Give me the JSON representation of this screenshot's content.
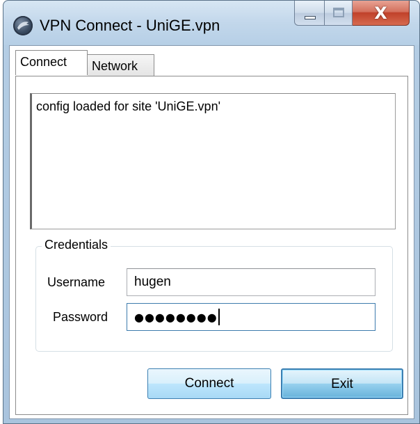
{
  "window": {
    "title": "VPN Connect - UniGE.vpn",
    "close_glyph": "X"
  },
  "tabs": [
    {
      "label": "Connect",
      "selected": true
    },
    {
      "label": "Network",
      "selected": false
    }
  ],
  "log": {
    "text": "config loaded for site 'UniGE.vpn'"
  },
  "credentials": {
    "legend": "Credentials",
    "username_label": "Username",
    "username_value": "hugen",
    "password_label": "Password",
    "password_mask": "●●●●●●●●"
  },
  "buttons": {
    "connect_label": "Connect",
    "exit_label": "Exit"
  },
  "icons": {
    "app": "vpn-globe-icon",
    "minimize": "minimize-icon",
    "maximize": "maximize-icon",
    "close": "close-icon"
  }
}
